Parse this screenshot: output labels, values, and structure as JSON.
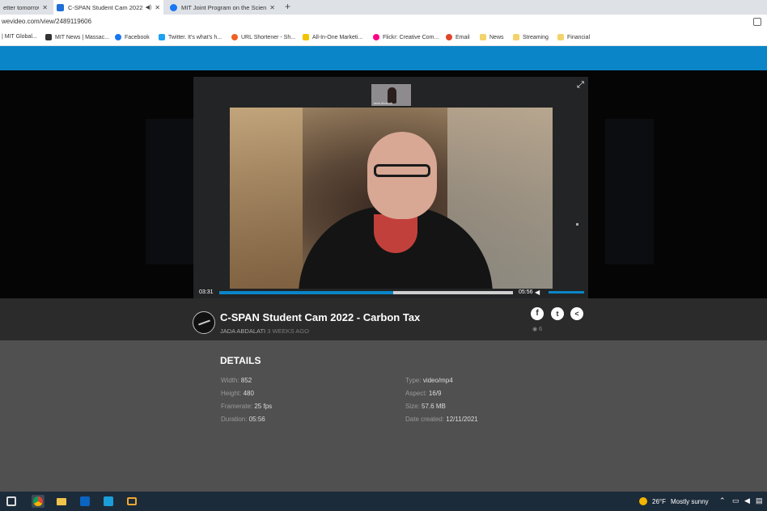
{
  "browser": {
    "tabs": [
      {
        "label": "etter tomorrow",
        "active": false,
        "audio": false
      },
      {
        "label": "C-SPAN Student Cam 2022 -",
        "active": true,
        "audio": true
      },
      {
        "label": "MIT Joint Program on the Science",
        "active": false,
        "audio": false
      }
    ],
    "url": "wevideo.com/view/2489119606",
    "bookmarks": [
      {
        "label": "| MIT Global...",
        "icon": "mit-icon",
        "color": "#ffffff"
      },
      {
        "label": "MIT News | Massac...",
        "icon": "mit-news-icon",
        "color": "#333333"
      },
      {
        "label": "Facebook",
        "icon": "facebook-icon",
        "color": "#1877f2"
      },
      {
        "label": "Twitter. It's what's h...",
        "icon": "twitter-icon",
        "color": "#1da1f2"
      },
      {
        "label": "URL Shortener - Sh...",
        "icon": "url-shortener-icon",
        "color": "#ee6123"
      },
      {
        "label": "All-In-One Marketi...",
        "icon": "marketing-icon",
        "color": "#f2c400"
      },
      {
        "label": "Flickr: Creative Com...",
        "icon": "flickr-icon",
        "color": "#ff0084"
      },
      {
        "label": "Email",
        "icon": "email-icon",
        "color": "#e0452a"
      },
      {
        "label": "News",
        "icon": "folder-icon",
        "color": "#f3d36b"
      },
      {
        "label": "Streaming",
        "icon": "folder-icon",
        "color": "#f3d36b"
      },
      {
        "label": "Financial",
        "icon": "folder-icon",
        "color": "#f3d36b"
      }
    ]
  },
  "player": {
    "current_time": "03:31",
    "total_time": "05:56",
    "progress": 0.593,
    "thumbnail_caption": "Jada Abdalati",
    "accent_color": "#0a86c8"
  },
  "video": {
    "title": "C-SPAN Student Cam 2022 - Carbon Tax",
    "author": "JADA ABDALATI",
    "posted": "3 WEEKS AGO",
    "views": "6"
  },
  "details": {
    "heading": "DETAILS",
    "left": [
      {
        "label": "Width:",
        "value": "852"
      },
      {
        "label": "Height:",
        "value": "480"
      },
      {
        "label": "Framerate:",
        "value": "25 fps"
      },
      {
        "label": "Duration:",
        "value": "05:56"
      }
    ],
    "right": [
      {
        "label": "Type:",
        "value": "video/mp4"
      },
      {
        "label": "Aspect:",
        "value": "16/9"
      },
      {
        "label": "Size:",
        "value": "57.6 MB"
      },
      {
        "label": "Date created:",
        "value": "12/11/2021"
      }
    ]
  },
  "taskbar": {
    "weather_temp": "26°F",
    "weather_text": "Mostly sunny",
    "apps": [
      "task-view-icon",
      "chrome-icon",
      "file-explorer-icon",
      "outlook-icon",
      "store-icon",
      "mail-icon"
    ]
  }
}
